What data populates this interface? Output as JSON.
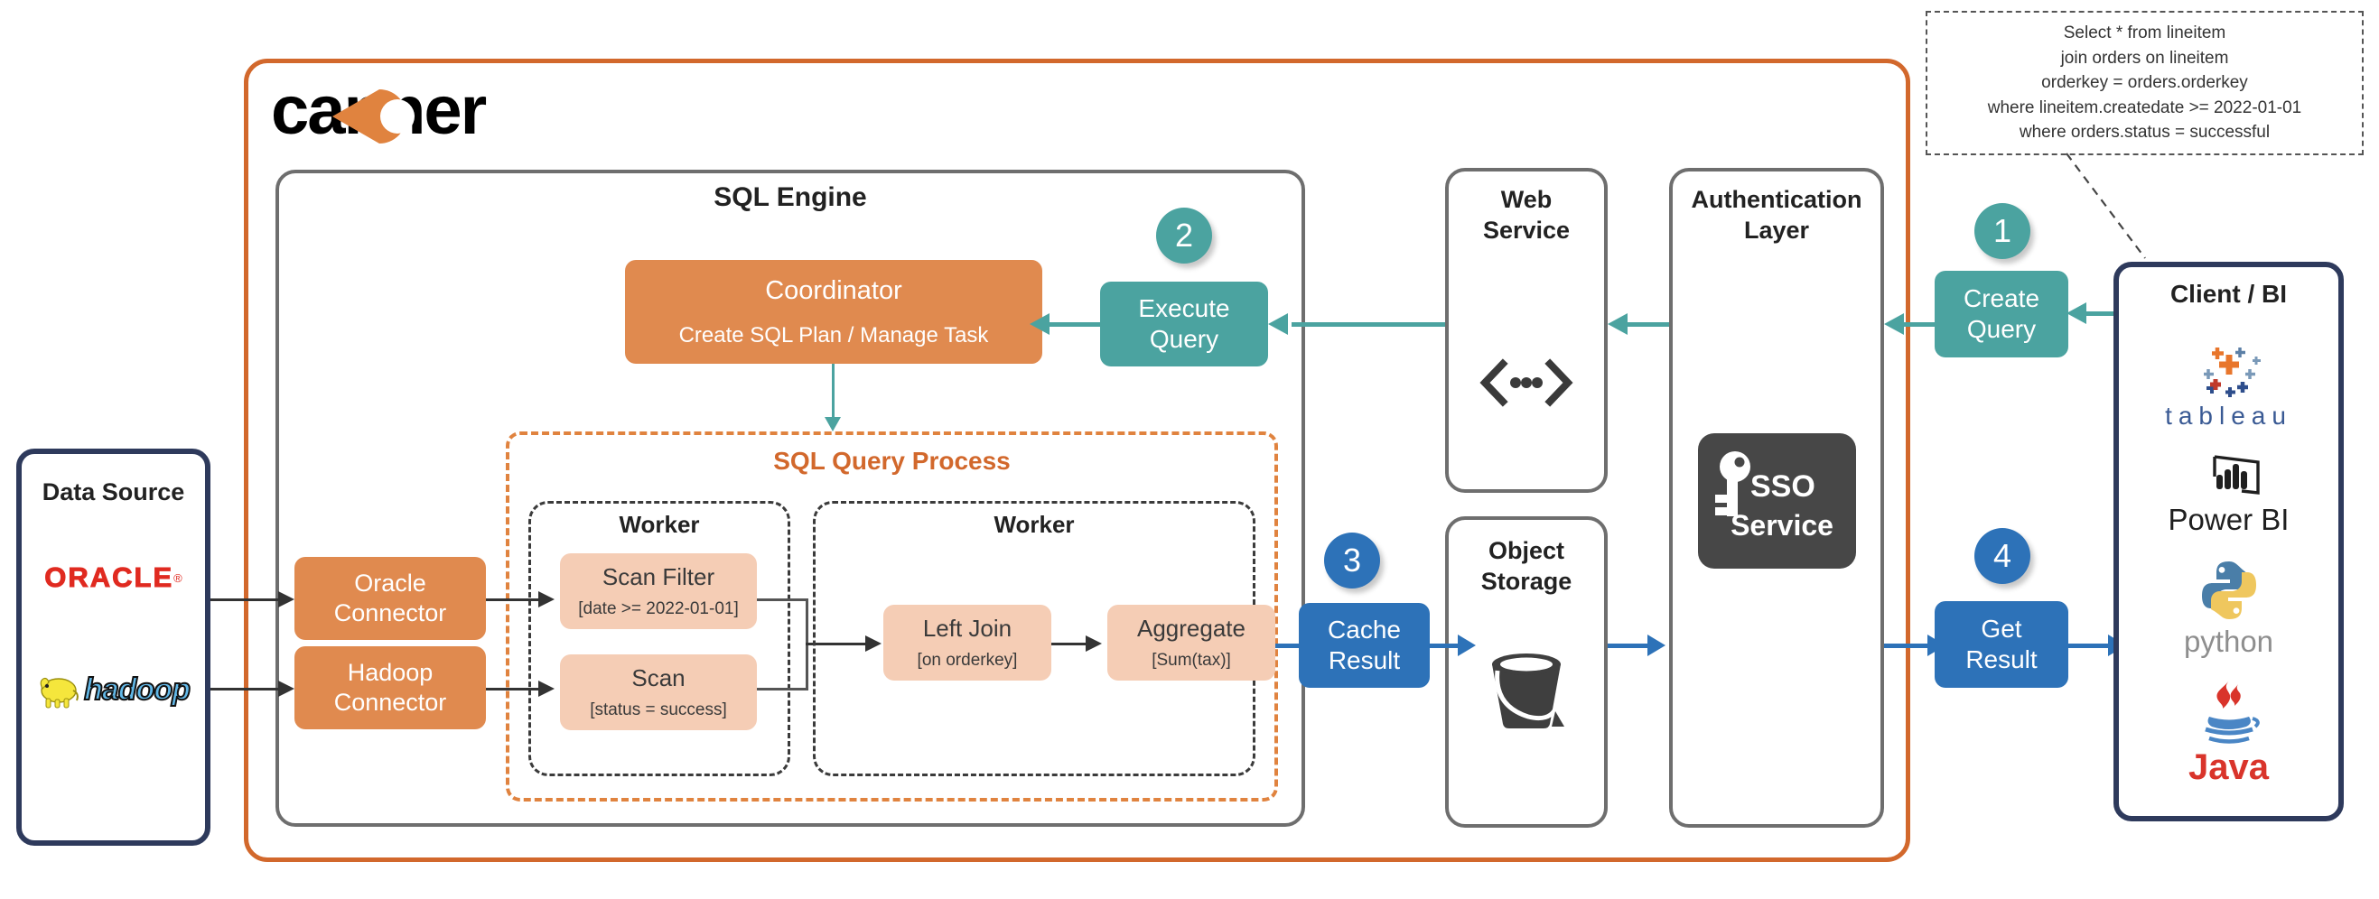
{
  "brand": {
    "logo_text": "canner"
  },
  "callout": {
    "lines": [
      "Select * from lineitem",
      "join orders on lineitem",
      "orderkey = orders.orderkey",
      "where lineitem.createdate >= 2022-01-01",
      "where orders.status = successful"
    ]
  },
  "data_source": {
    "title": "Data Source",
    "sources": [
      {
        "name": "oracle-logo",
        "label": "ORACLE"
      },
      {
        "name": "hadoop-logo",
        "label": "hadoop"
      }
    ]
  },
  "connectors": [
    {
      "line1": "Oracle",
      "line2": "Connector"
    },
    {
      "line1": "Hadoop",
      "line2": "Connector"
    }
  ],
  "sql_engine": {
    "title": "SQL Engine",
    "coordinator": {
      "title": "Coordinator",
      "subtitle": "Create SQL Plan / Manage Task"
    },
    "process": {
      "title": "SQL Query Process",
      "workers": [
        {
          "title": "Worker",
          "ops": [
            {
              "name": "Scan Filter",
              "detail": "[date >= 2022-01-01]"
            },
            {
              "name": "Scan",
              "detail": "[status = success]"
            }
          ]
        },
        {
          "title": "Worker",
          "ops": [
            {
              "name": "Left Join",
              "detail": "[on orderkey]"
            },
            {
              "name": "Aggregate",
              "detail": "[Sum(tax)]"
            }
          ]
        }
      ]
    }
  },
  "services": {
    "web_service": {
      "line1": "Web",
      "line2": "Service",
      "icon": "api-code-icon"
    },
    "object_storage": {
      "line1": "Object",
      "line2": "Storage",
      "icon": "bucket-icon"
    },
    "auth_layer": {
      "line1": "Authentication",
      "line2": "Layer"
    },
    "sso": {
      "line1": "SSO",
      "line2": "Service",
      "icon": "key-icon"
    }
  },
  "steps": [
    {
      "number": "1",
      "line1": "Create",
      "line2": "Query",
      "color": "#4BA3A0"
    },
    {
      "number": "2",
      "line1": "Execute",
      "line2": "Query",
      "color": "#4BA3A0"
    },
    {
      "number": "3",
      "line1": "Cache",
      "line2": "Result",
      "color": "#2D72B8"
    },
    {
      "number": "4",
      "line1": "Get",
      "line2": "Result",
      "color": "#2D72B8"
    }
  ],
  "client_bi": {
    "title": "Client / BI",
    "tools": [
      {
        "name": "tableau-logo",
        "label": "tableau"
      },
      {
        "name": "powerbi-logo",
        "label": "Power BI"
      },
      {
        "name": "python-logo",
        "label": "python"
      },
      {
        "name": "java-logo",
        "label": "Java"
      }
    ]
  },
  "colors": {
    "orange": "#D2682C",
    "orange_fill": "#E08A4F",
    "peach": "#F5CDB5",
    "teal": "#4BA3A0",
    "blue": "#2D72B8",
    "navy": "#2E3A5C",
    "gray": "#6E6E6E"
  }
}
